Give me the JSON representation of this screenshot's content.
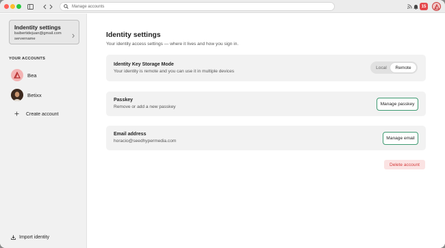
{
  "app": {
    "search_placeholder": "Manage accounts",
    "notification_count": "15"
  },
  "sidebar": {
    "current_account": {
      "title": "Indentity settings",
      "email": "baibertidejuan@gmail.com",
      "server": "servername"
    },
    "section_label": "YOUR ACCOUNTS",
    "accounts": [
      {
        "name": "Bea",
        "avatar_color": "#f3b3b3"
      },
      {
        "name": "Betixx",
        "avatar_color": "#5a3a2a"
      }
    ],
    "create_label": "Create account",
    "import_label": "Import identity"
  },
  "main": {
    "title": "Identity settings",
    "subtitle": "Your identity access settings — where it lives and how you sign in.",
    "key_storage": {
      "title": "Identity Key Storage Mode",
      "description": "Your identity is remote and you can use it in multiple devices",
      "options": [
        "Local",
        "Remote"
      ],
      "selected": "Remote"
    },
    "passkey": {
      "title": "Passkey",
      "description": "Remove or add a new passkey",
      "button": "Manage passkey"
    },
    "email": {
      "title": "Email address",
      "value": "horacio@seedhypermedia.com",
      "button": "Manage email"
    },
    "delete_label": "Delete account"
  },
  "colors": {
    "accent_green": "#3d9970",
    "danger": "#d33a3a",
    "badge": "#e5484d"
  }
}
